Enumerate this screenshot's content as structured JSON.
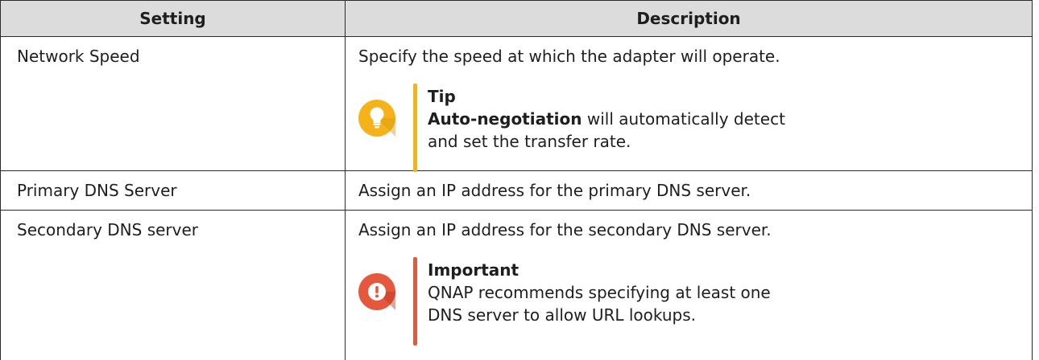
{
  "table": {
    "headers": {
      "setting": "Setting",
      "description": "Description"
    },
    "rows": [
      {
        "setting": "Network Speed",
        "description": "Specify the speed at which the adapter will operate.",
        "note": {
          "kind": "tip",
          "icon": "lightbulb-icon",
          "color": "#F5B21B",
          "title": "Tip",
          "text_bold": "Auto-negotiation",
          "text": " will automatically detect and set the transfer rate."
        }
      },
      {
        "setting": "Primary DNS Server",
        "description": "Assign an IP address for the primary DNS server."
      },
      {
        "setting": "Secondary DNS server",
        "description": "Assign an IP address for the secondary DNS server.",
        "note": {
          "kind": "important",
          "icon": "exclamation-icon",
          "color": "#E5583B",
          "title": "Important",
          "text": "QNAP recommends specifying at least one DNS server to allow URL lookups."
        }
      }
    ]
  },
  "colors": {
    "header_bg": "#DCDCDC",
    "border": "#2B2B2B",
    "text": "#1E1E1E"
  }
}
